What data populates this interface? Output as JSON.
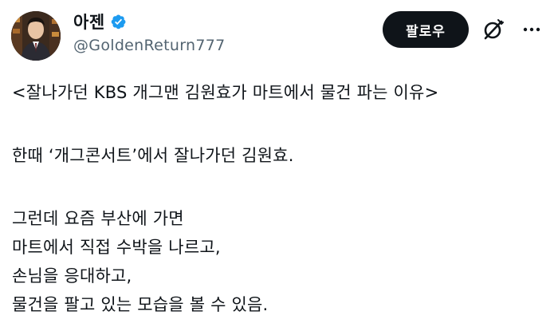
{
  "author": {
    "display_name": "아젠",
    "handle": "@GoldenReturn777",
    "verified": true
  },
  "actions": {
    "follow_label": "팔로우",
    "grok_icon": "grok-icon",
    "more_icon": "more-icon"
  },
  "post": {
    "lines": [
      "<잘나가던 KBS 개그맨 김원효가 마트에서 물건 파는 이유>",
      "한때 ‘개그콘서트’에서 잘나가던 김원효.",
      "그런데 요즘 부산에 가면",
      "마트에서 직접 수박을 나르고,",
      "손님을 응대하고,",
      "물건을 팔고 있는 모습을 볼 수 있음."
    ]
  },
  "colors": {
    "text": "#0f1419",
    "secondary": "#536471",
    "verified_badge": "#1d9bf0",
    "follow_button_bg": "#0f1419"
  }
}
